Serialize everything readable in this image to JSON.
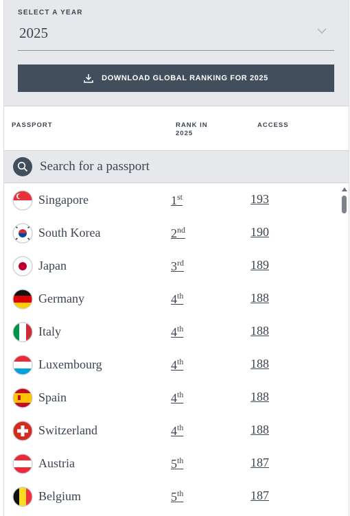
{
  "year_selector": {
    "label": "SELECT A YEAR",
    "value": "2025"
  },
  "download_button": {
    "label": "DOWNLOAD GLOBAL RANKING FOR 2025"
  },
  "table_header": {
    "passport": "PASSPORT",
    "rank_line1": "RANK IN",
    "rank_line2": "2025",
    "access": "ACCESS"
  },
  "search": {
    "placeholder": "Search for a passport"
  },
  "rows": [
    {
      "country": "Singapore",
      "rank_num": "1",
      "rank_suffix": "st",
      "access": "193",
      "flag_icon": "singapore-flag-icon"
    },
    {
      "country": "South Korea",
      "rank_num": "2",
      "rank_suffix": "nd",
      "access": "190",
      "flag_icon": "south-korea-flag-icon"
    },
    {
      "country": "Japan",
      "rank_num": "3",
      "rank_suffix": "rd",
      "access": "189",
      "flag_icon": "japan-flag-icon"
    },
    {
      "country": "Germany",
      "rank_num": "4",
      "rank_suffix": "th",
      "access": "188",
      "flag_icon": "germany-flag-icon"
    },
    {
      "country": "Italy",
      "rank_num": "4",
      "rank_suffix": "th",
      "access": "188",
      "flag_icon": "italy-flag-icon"
    },
    {
      "country": "Luxembourg",
      "rank_num": "4",
      "rank_suffix": "th",
      "access": "188",
      "flag_icon": "luxembourg-flag-icon"
    },
    {
      "country": "Spain",
      "rank_num": "4",
      "rank_suffix": "th",
      "access": "188",
      "flag_icon": "spain-flag-icon"
    },
    {
      "country": "Switzerland",
      "rank_num": "4",
      "rank_suffix": "th",
      "access": "188",
      "flag_icon": "switzerland-flag-icon"
    },
    {
      "country": "Austria",
      "rank_num": "5",
      "rank_suffix": "th",
      "access": "187",
      "flag_icon": "austria-flag-icon"
    },
    {
      "country": "Belgium",
      "rank_num": "5",
      "rank_suffix": "th",
      "access": "187",
      "flag_icon": "belgium-flag-icon"
    }
  ],
  "colors": {
    "button_bg": "#434e5d",
    "panel_bg": "#e6e8eb",
    "text": "#3d4450"
  }
}
